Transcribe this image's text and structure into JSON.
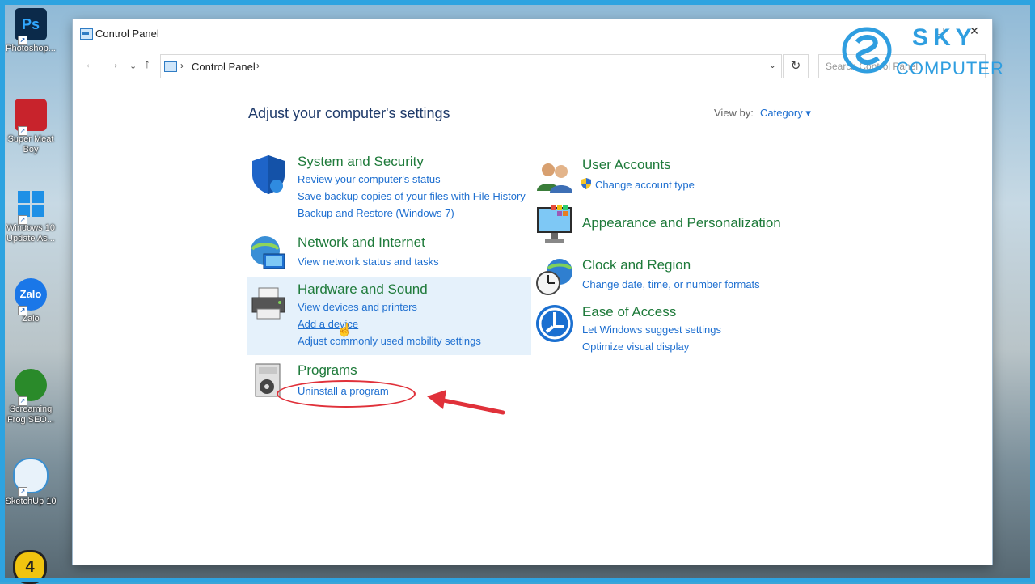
{
  "desktop": {
    "icons": [
      {
        "label": "Photoshop...",
        "color": "#0b2a4a",
        "glyph": "Ps"
      },
      {
        "label": "Super Meat\nBoy",
        "color": "#c8232c",
        "glyph": ""
      },
      {
        "label": "Windows 10\nUpdate As...",
        "color": "#1e90e6",
        "glyph": ""
      },
      {
        "label": "Zalo",
        "color": "#1a77e8",
        "glyph": "Zalo"
      },
      {
        "label": "Screaming\nFrog SEO...",
        "color": "#2a8a2a",
        "glyph": ""
      },
      {
        "label": "SketchUp 10",
        "color": "#3a8fd0",
        "glyph": ""
      }
    ]
  },
  "window": {
    "title": "Control Panel",
    "controls": {
      "minimize": "–",
      "maximize": "□",
      "close": "✕"
    }
  },
  "navigation": {
    "back": "←",
    "forward": "→",
    "recent": "⌄",
    "up": "↑",
    "address": {
      "separator": "›",
      "path": "Control Panel"
    },
    "dropdown": "⌄",
    "refresh": "↻",
    "search_placeholder": "Search Control Panel"
  },
  "content": {
    "heading": "Adjust your computer's settings",
    "view_by_label": "View by:",
    "view_by_value": "Category ▾",
    "left_categories": [
      {
        "title": "System and Security",
        "icon": "shield-icon",
        "links": [
          "Review your computer's status",
          "Save backup copies of your files with File History",
          "Backup and Restore (Windows 7)"
        ]
      },
      {
        "title": "Network and Internet",
        "icon": "globe-network-icon",
        "links": [
          "View network status and tasks"
        ]
      },
      {
        "title": "Hardware and Sound",
        "icon": "printer-icon",
        "links": [
          "View devices and printers",
          "Add a device",
          "Adjust commonly used mobility settings"
        ]
      },
      {
        "title": "Programs",
        "icon": "programs-icon",
        "links": [
          "Uninstall a program"
        ]
      }
    ],
    "right_categories": [
      {
        "title": "User Accounts",
        "icon": "users-icon",
        "links": [
          "Change account type"
        ]
      },
      {
        "title": "Appearance and Personalization",
        "icon": "monitor-color-icon",
        "links": []
      },
      {
        "title": "Clock and Region",
        "icon": "clock-globe-icon",
        "links": [
          "Change date, time, or number formats"
        ]
      },
      {
        "title": "Ease of Access",
        "icon": "accessibility-icon",
        "links": [
          "Let Windows suggest settings",
          "Optimize visual display"
        ]
      }
    ]
  },
  "logo": {
    "line1": "SKY",
    "line2": "COMPUTER",
    "color": "#2f9ee0"
  },
  "colors": {
    "link": "#1e6fd0",
    "category_title": "#1e7a3a",
    "highlight": "#e5f1fb",
    "annotation": "#e0313a"
  }
}
